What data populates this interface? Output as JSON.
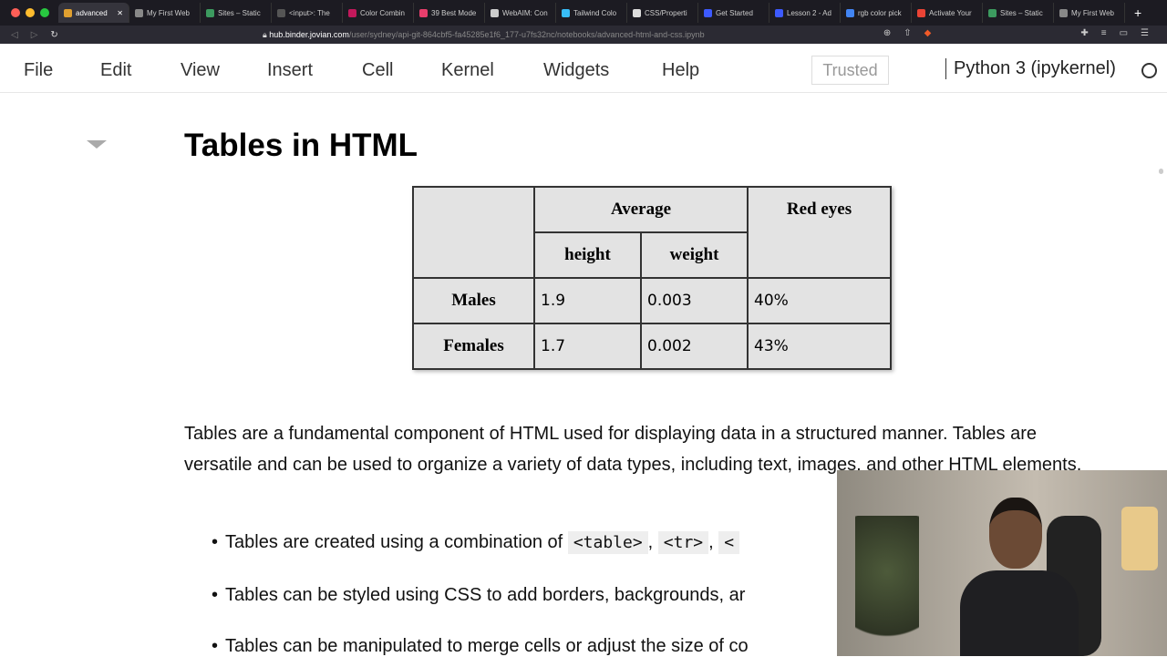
{
  "browser": {
    "tabs": [
      {
        "label": "advanced",
        "active": true,
        "color": "#e0a030"
      },
      {
        "label": "My First Web",
        "color": "#888"
      },
      {
        "label": "Sites – Static",
        "color": "#3c9a5f"
      },
      {
        "label": "<input>: The",
        "color": "#555"
      },
      {
        "label": "Color Combin",
        "color": "#c2185b"
      },
      {
        "label": "39 Best Mode",
        "color": "#e83e6c"
      },
      {
        "label": "WebAIM: Con",
        "color": "#ccc"
      },
      {
        "label": "Tailwind Colo",
        "color": "#38bdf8"
      },
      {
        "label": "CSS/Properti",
        "color": "#ddd"
      },
      {
        "label": "Get Started",
        "color": "#3d5afe"
      },
      {
        "label": "Lesson 2 - Ad",
        "color": "#3d5afe"
      },
      {
        "label": "rgb color pick",
        "color": "#4285f4"
      },
      {
        "label": "Activate Your",
        "color": "#ea4335"
      },
      {
        "label": "Sites – Static",
        "color": "#3c9a5f"
      },
      {
        "label": "My First Web",
        "color": "#888"
      }
    ],
    "new_tab": "+",
    "url_host": "hub.binder.jovian.com",
    "url_path": "/user/sydney/api-git-864cbf5-fa45285e1f6_177-u7fs32nc/notebooks/advanced-html-and-css.ipynb"
  },
  "menubar": {
    "items": [
      "File",
      "Edit",
      "View",
      "Insert",
      "Cell",
      "Kernel",
      "Widgets",
      "Help"
    ],
    "trusted": "Trusted",
    "kernel": "Python 3 (ipykernel)"
  },
  "content": {
    "heading": "Tables in HTML",
    "table": {
      "group_header": "Average",
      "sub_headers": [
        "height",
        "weight"
      ],
      "last_header": "Red eyes",
      "rows": [
        {
          "label": "Males",
          "height": "1.9",
          "weight": "0.003",
          "red_eyes": "40%"
        },
        {
          "label": "Females",
          "height": "1.7",
          "weight": "0.002",
          "red_eyes": "43%"
        }
      ]
    },
    "paragraph": "Tables are a fundamental component of HTML used for displaying data in a structured manner. Tables are versatile and can be used to organize a variety of data types, including text, images, and other HTML elements.",
    "bullets": {
      "b1_text": "Tables are created using a combination of",
      "b1_codes": [
        "<table>",
        "<tr>",
        "<"
      ],
      "b2": "Tables can be styled using CSS to add borders, backgrounds, ar",
      "b3": "Tables can be manipulated to merge cells or adjust the size of co"
    }
  }
}
